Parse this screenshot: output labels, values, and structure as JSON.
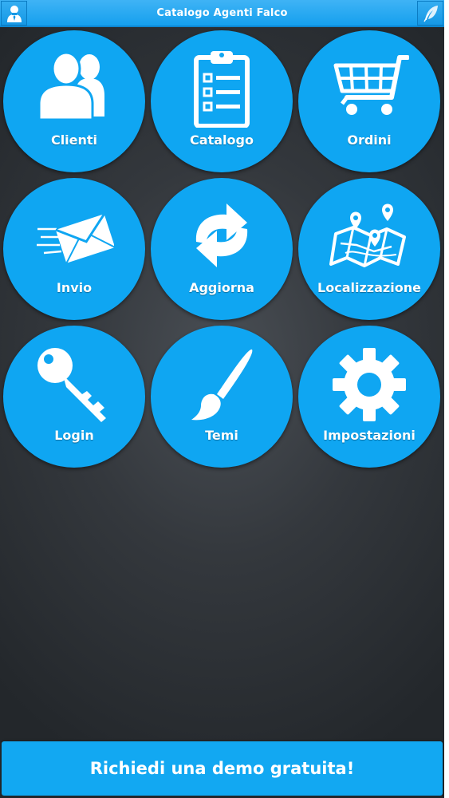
{
  "header": {
    "title": "Catalogo Agenti Falco",
    "left_icon": "user-icon",
    "right_icon": "feather-icon"
  },
  "menu": [
    {
      "label": "Clienti",
      "icon": "users-icon"
    },
    {
      "label": "Catalogo",
      "icon": "clipboard-list-icon"
    },
    {
      "label": "Ordini",
      "icon": "cart-icon"
    },
    {
      "label": "Invio",
      "icon": "envelope-send-icon"
    },
    {
      "label": "Aggiorna",
      "icon": "refresh-icon"
    },
    {
      "label": "Localizzazione",
      "icon": "map-icon"
    },
    {
      "label": "Login",
      "icon": "key-icon"
    },
    {
      "label": "Temi",
      "icon": "brush-icon"
    },
    {
      "label": "Impostazioni",
      "icon": "gear-icon"
    }
  ],
  "footer": {
    "demo_label": "Richiedi una demo gratuita!"
  },
  "colors": {
    "accent": "#0fa6f2",
    "background": "#34383d"
  }
}
